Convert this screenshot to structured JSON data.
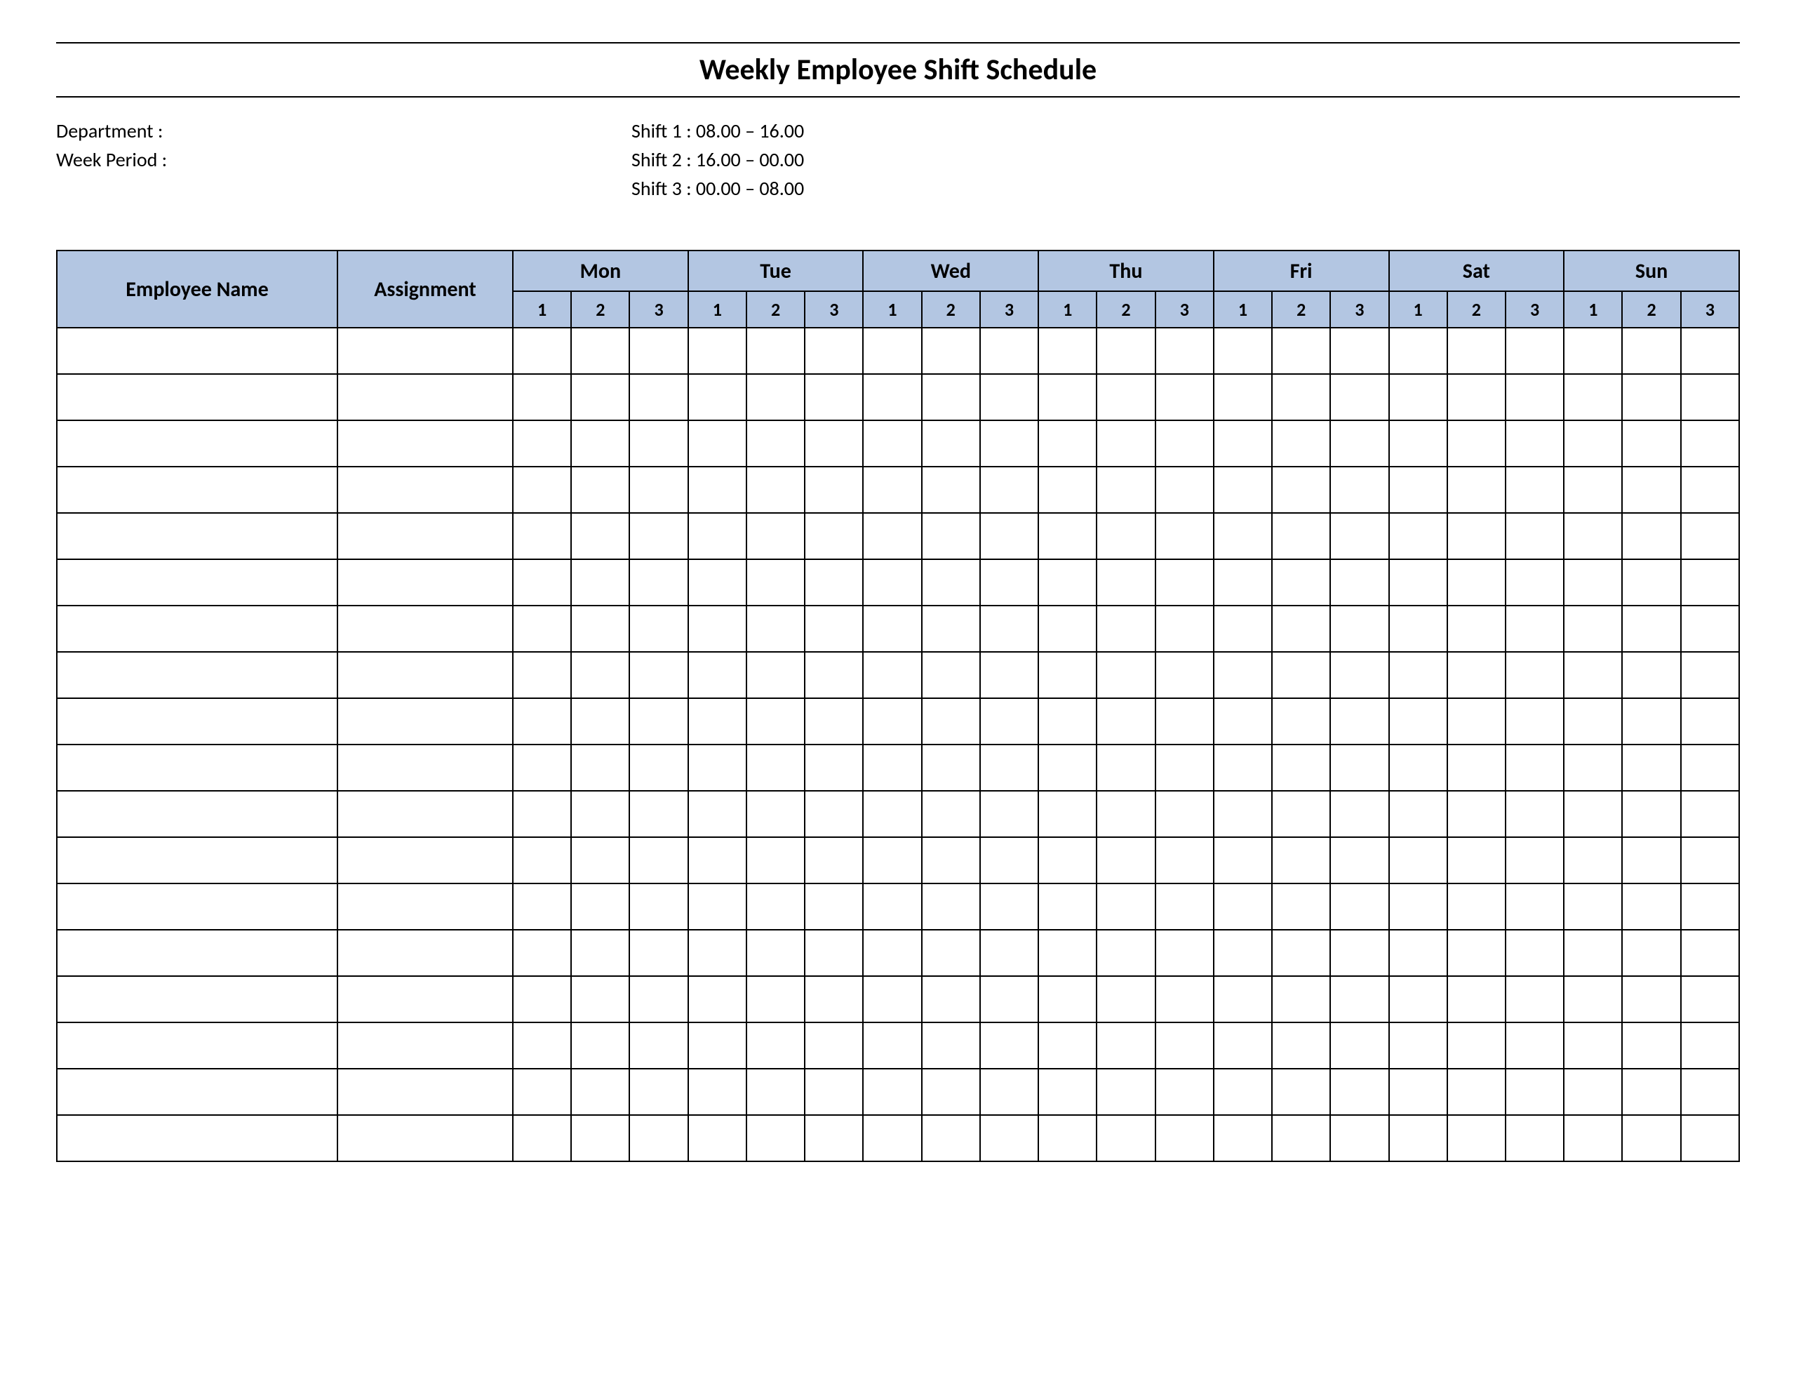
{
  "title": "Weekly Employee Shift Schedule",
  "meta": {
    "department_label": "Department    :",
    "week_period_label": "Week  Period :",
    "shift1": "Shift 1  : 08.00  – 16.00",
    "shift2": "Shift 2  : 16.00  – 00.00",
    "shift3": "Shift 3  : 00.00  – 08.00"
  },
  "headers": {
    "employee_name": "Employee Name",
    "assignment": "Assignment",
    "days": [
      "Mon",
      "Tue",
      "Wed",
      "Thu",
      "Fri",
      "Sat",
      "Sun"
    ],
    "shifts": [
      "1",
      "2",
      "3"
    ]
  },
  "row_count": 18
}
